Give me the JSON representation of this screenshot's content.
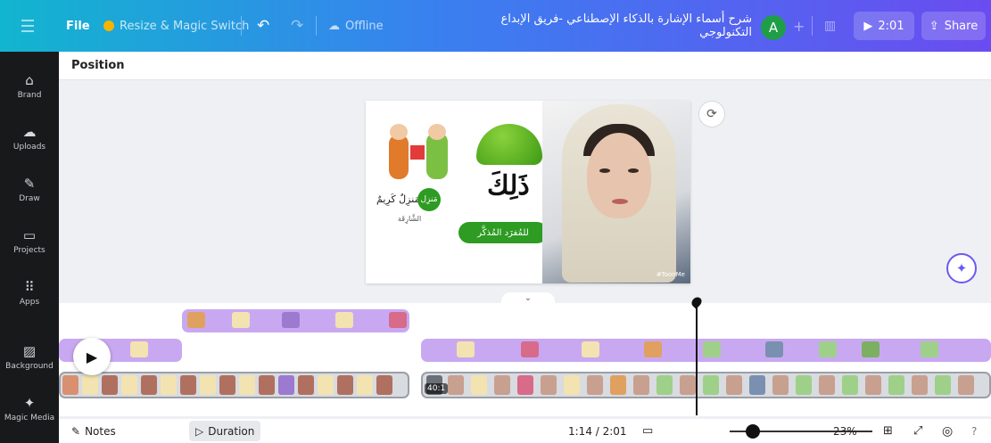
{
  "topbar": {
    "file": "File",
    "resize": "Resize & Magic Switch",
    "offline": "Offline",
    "title": "شرح أسماء الإشارة بالذكاء الإصطناعي -فريق الإبداع التكنولوجي",
    "avatar_letter": "A",
    "present_time": "2:01",
    "share": "Share",
    "undo_icon": "undo-icon",
    "redo_icon": "redo-icon"
  },
  "sidebar": {
    "items": [
      {
        "label": "Brand",
        "icon": "brand-icon"
      },
      {
        "label": "Uploads",
        "icon": "uploads-icon"
      },
      {
        "label": "Draw",
        "icon": "draw-icon"
      },
      {
        "label": "Projects",
        "icon": "projects-icon"
      },
      {
        "label": "Apps",
        "icon": "apps-icon"
      },
      {
        "label": "Background",
        "icon": "background-icon"
      },
      {
        "label": "Magic Media",
        "icon": "magic-media-icon"
      }
    ]
  },
  "position_bar": {
    "label": "Position"
  },
  "slide": {
    "big_word": "ذَلِكَ",
    "pill_text": "للمُفرَد المُذكَّر",
    "small_phrase": "ذَلِكَ مَنزِلٌ كَرِيمٌ",
    "circle_word": "مَنزِل",
    "caption": "الشَّارِقَة",
    "watermark": "#ToonMe"
  },
  "timeline": {
    "video_badge": "40:1"
  },
  "bottombar": {
    "notes": "Notes",
    "duration": "Duration",
    "time": "1:14 / 2:01",
    "zoom": "23%",
    "zoom_value": 0.16
  }
}
